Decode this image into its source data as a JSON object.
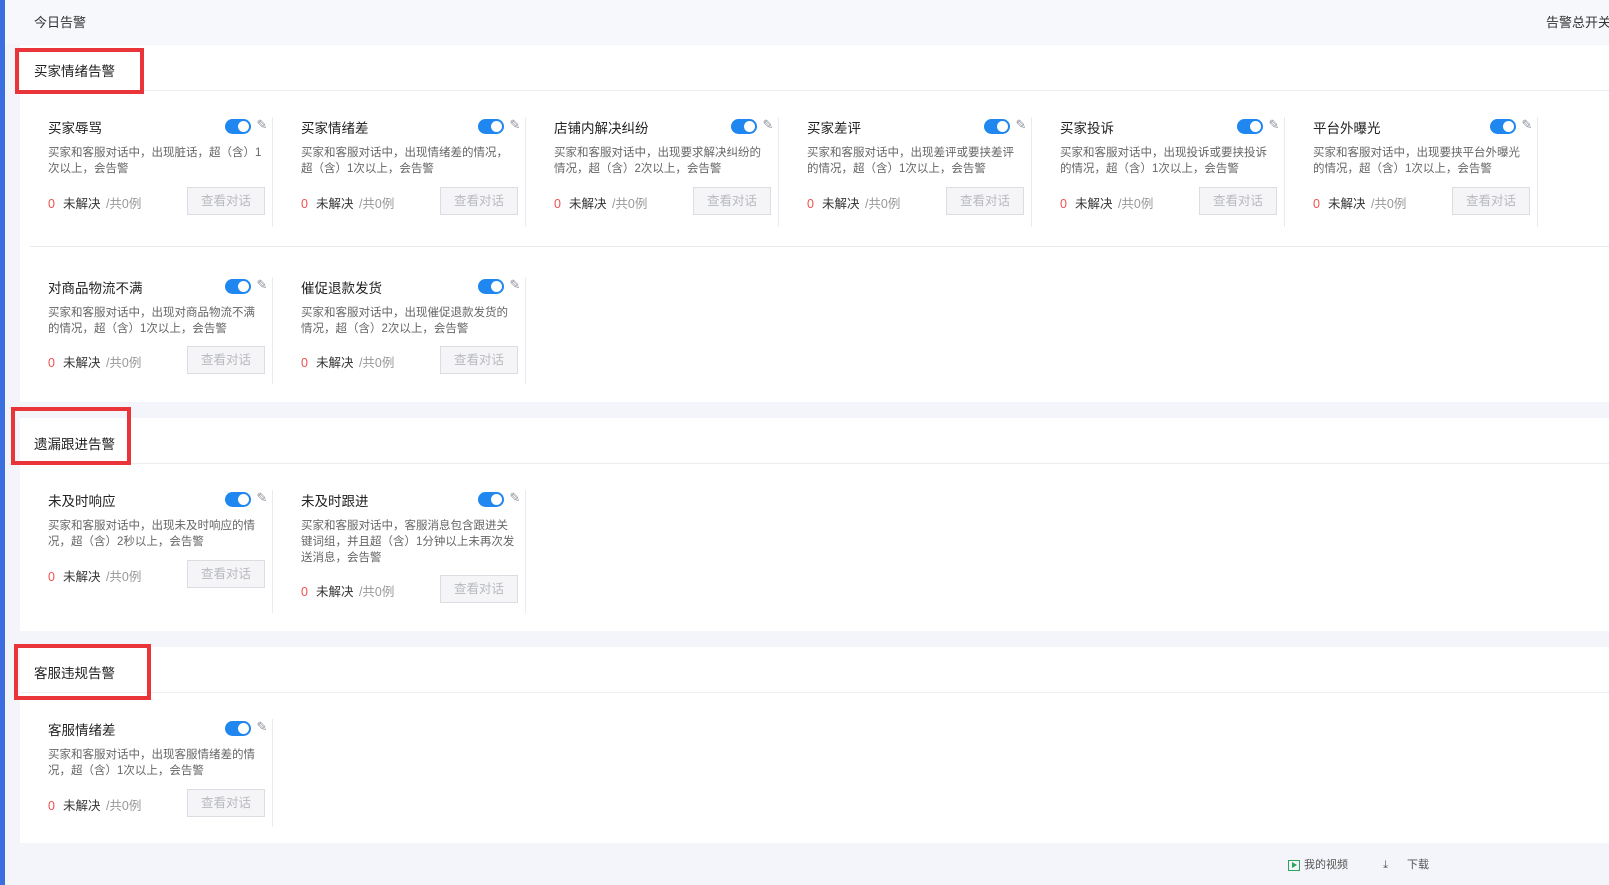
{
  "header": {
    "title": "今日告警",
    "master_switch_label": "告警总开关"
  },
  "sections": [
    {
      "title": "买家情绪告警",
      "cards": [
        {
          "name": "买家辱骂",
          "desc": "买家和客服对话中，出现脏话，超（含）1次以上，会告警",
          "count": "0",
          "unresolved": "未解决",
          "total": "/共0例",
          "button": "查看对话",
          "enabled": true
        },
        {
          "name": "买家情绪差",
          "desc": "买家和客服对话中，出现情绪差的情况，超（含）1次以上，会告警",
          "count": "0",
          "unresolved": "未解决",
          "total": "/共0例",
          "button": "查看对话",
          "enabled": true
        },
        {
          "name": "店铺内解决纠纷",
          "desc": "买家和客服对话中，出现要求解决纠纷的情况，超（含）2次以上，会告警",
          "count": "0",
          "unresolved": "未解决",
          "total": "/共0例",
          "button": "查看对话",
          "enabled": true
        },
        {
          "name": "买家差评",
          "desc": "买家和客服对话中，出现差评或要挟差评的情况，超（含）1次以上，会告警",
          "count": "0",
          "unresolved": "未解决",
          "total": "/共0例",
          "button": "查看对话",
          "enabled": true
        },
        {
          "name": "买家投诉",
          "desc": "买家和客服对话中，出现投诉或要挟投诉的情况，超（含）1次以上，会告警",
          "count": "0",
          "unresolved": "未解决",
          "total": "/共0例",
          "button": "查看对话",
          "enabled": true
        },
        {
          "name": "平台外曝光",
          "desc": "买家和客服对话中，出现要挟平台外曝光的情况，超（含）1次以上，会告警",
          "count": "0",
          "unresolved": "未解决",
          "total": "/共0例",
          "button": "查看对话",
          "enabled": true
        },
        {
          "name": "对商品物流不满",
          "desc": "买家和客服对话中，出现对商品物流不满的情况，超（含）1次以上，会告警",
          "count": "0",
          "unresolved": "未解决",
          "total": "/共0例",
          "button": "查看对话",
          "enabled": true
        },
        {
          "name": "催促退款发货",
          "desc": "买家和客服对话中，出现催促退款发货的情况，超（含）2次以上，会告警",
          "count": "0",
          "unresolved": "未解决",
          "total": "/共0例",
          "button": "查看对话",
          "enabled": true
        }
      ]
    },
    {
      "title": "遗漏跟进告警",
      "cards": [
        {
          "name": "未及时响应",
          "desc": "买家和客服对话中，出现未及时响应的情况，超（含）2秒以上，会告警",
          "count": "0",
          "unresolved": "未解决",
          "total": "/共0例",
          "button": "查看对话",
          "enabled": true
        },
        {
          "name": "未及时跟进",
          "desc": "买家和客服对话中，客服消息包含跟进关键词组，并且超（含）1分钟以上未再次发送消息，会告警",
          "count": "0",
          "unresolved": "未解决",
          "total": "/共0例",
          "button": "查看对话",
          "enabled": true
        }
      ]
    },
    {
      "title": "客服违规告警",
      "cards": [
        {
          "name": "客服情绪差",
          "desc": "买家和客服对话中，出现客服情绪差的情况，超（含）1次以上，会告警",
          "count": "0",
          "unresolved": "未解决",
          "total": "/共0例",
          "button": "查看对话",
          "enabled": true
        }
      ]
    }
  ],
  "bottom_bar": {
    "items": [
      "我的视频",
      "下载"
    ]
  },
  "colors": {
    "accent": "#1f87ef",
    "highlight": "#e9353a",
    "count": "#f05050"
  },
  "icons": [
    "edit-icon",
    "toggle-switch",
    "play-icon"
  ]
}
